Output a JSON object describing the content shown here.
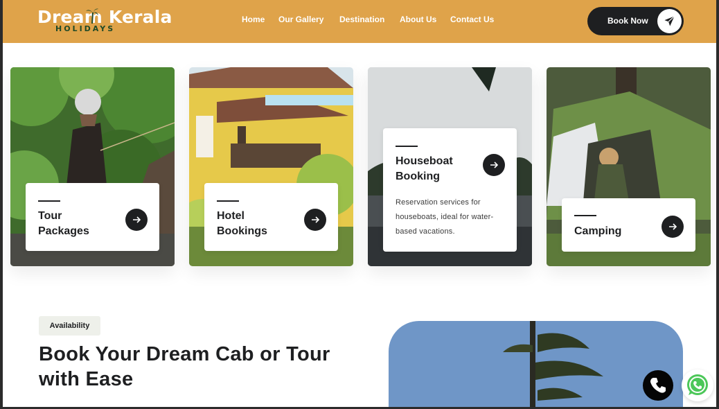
{
  "brand": {
    "name": "Dream Kerala",
    "sub": "HOLIDAYS"
  },
  "nav": [
    "Home",
    "Our Gallery",
    "Destination",
    "About Us",
    "Contact Us"
  ],
  "header_button": {
    "label": "Book Now",
    "icon": "send-icon"
  },
  "cards": [
    {
      "title_1": "Tour",
      "title_2": "Packages",
      "icon": "arrow-right-icon"
    },
    {
      "title_1": "Hotel",
      "title_2": "Bookings",
      "icon": "arrow-right-icon"
    },
    {
      "title_1": "Houseboat",
      "title_2": "Booking",
      "desc": "Reservation services for houseboats, ideal for water-based vacations.",
      "icon": "arrow-right-icon"
    },
    {
      "title_1": "Camping",
      "icon": "arrow-right-icon"
    }
  ],
  "availability": {
    "tag": "Availability",
    "headline_1": "Book Your Dream Cab or Tour",
    "headline_2": "with Ease"
  },
  "floating": {
    "call_icon": "phone-icon",
    "chat_icon": "whatsapp-icon"
  },
  "colors": {
    "header": "#dfa34a",
    "dark": "#1e1f21",
    "logo_sub": "#214a27"
  }
}
